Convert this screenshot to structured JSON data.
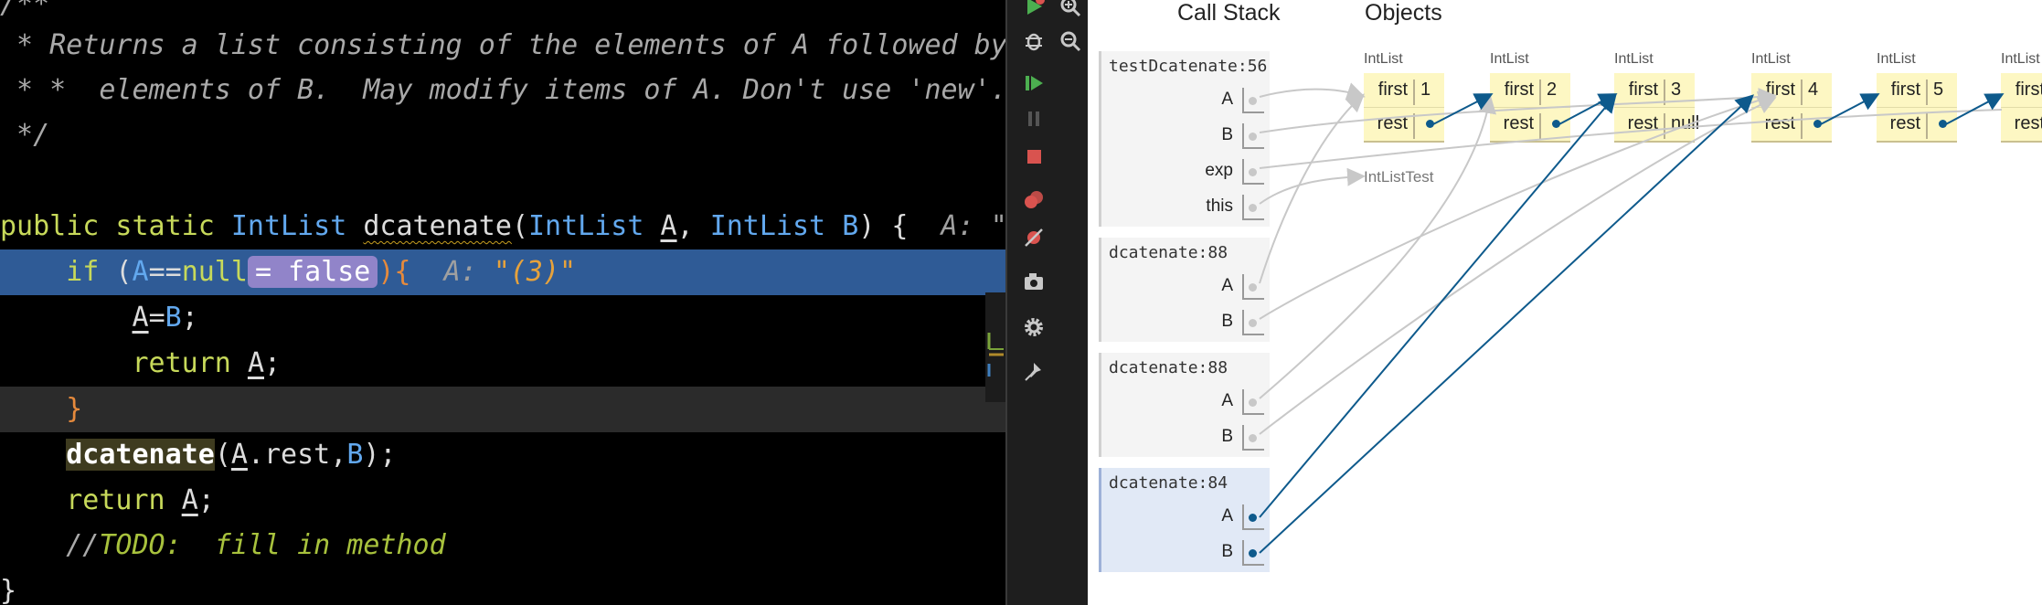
{
  "editor": {
    "lines": {
      "l0": "/**",
      "l1": " * Returns a list consisting of the elements of A followed by the",
      "l2": " * *  elements of B.  May modify items of A. Don't use 'new'.",
      "l3": " */",
      "l5_kw": "public static ",
      "l5_type": "IntList",
      "l5_fn": "dcatenate",
      "l5_open": "(",
      "l5_t1": "IntList",
      "l5_a": "A",
      "l5_comma": ", ",
      "l5_t2": "IntList",
      "l5_b": "B",
      "l5_close": ") {",
      "l5_inline": "  A: \"",
      "l6_if": "if",
      "l6_paren": " (",
      "l6_a": "A",
      "l6_eq": "==",
      "l6_null": "null",
      "l6_badge": "= false",
      "l6_close": "){",
      "l6_inline_lbl": "  A: ",
      "l6_inline_val": "\"(3)\"",
      "l7_a": "A",
      "l7_eq": "=",
      "l7_b": "B",
      "l7_semi": ";",
      "l8_ret": "return ",
      "l8_a": "A",
      "l8_semi": ";",
      "l9_brace": "}",
      "l10_fn": "dcatenate",
      "l10_open": "(",
      "l10_a": "A",
      "l10_rest": ".rest,",
      "l10_b": "B",
      "l10_close": ");",
      "l11_ret": "return ",
      "l11_a": "A",
      "l11_semi": ";",
      "l12_slash": "//",
      "l12_todo": "TODO:  fill in method",
      "l13_brace": "}"
    }
  },
  "toolbar": {
    "icons": [
      "run-icon",
      "zoom-in-icon",
      "debug-icon",
      "zoom-out-icon",
      "resume-icon",
      "pause-icon",
      "stop-icon",
      "breakpoints-icon",
      "mute-breakpoints-icon",
      "camera-icon",
      "settings-icon",
      "pin-icon"
    ]
  },
  "viz": {
    "call_stack_title": "Call Stack",
    "objects_title": "Objects",
    "frames": [
      {
        "name": "testDcatenate:56",
        "vars": [
          "A",
          "B",
          "exp",
          "this"
        ]
      },
      {
        "name": "dcatenate:88",
        "vars": [
          "A",
          "B"
        ]
      },
      {
        "name": "dcatenate:88",
        "vars": [
          "A",
          "B"
        ]
      },
      {
        "name": "dcatenate:84",
        "vars": [
          "A",
          "B"
        ]
      }
    ],
    "object_label": "IntList",
    "first_label": "first",
    "rest_label": "rest",
    "nodes": [
      {
        "first": "1",
        "rest": ""
      },
      {
        "first": "2",
        "rest": ""
      },
      {
        "first": "3",
        "rest": "null"
      },
      {
        "first": "4",
        "rest": ""
      },
      {
        "first": "5",
        "rest": ""
      },
      {
        "first": "",
        "rest": ""
      }
    ],
    "test_object_label": "IntListTest"
  },
  "colors": {
    "editor_bg": "#000000",
    "current_line": "#2f5b96",
    "active_frame": "#e1e9f6",
    "node_fill": "#fdf7c3",
    "active_arrow": "#0e5a8c",
    "inactive_arrow": "#c8c8c8"
  }
}
